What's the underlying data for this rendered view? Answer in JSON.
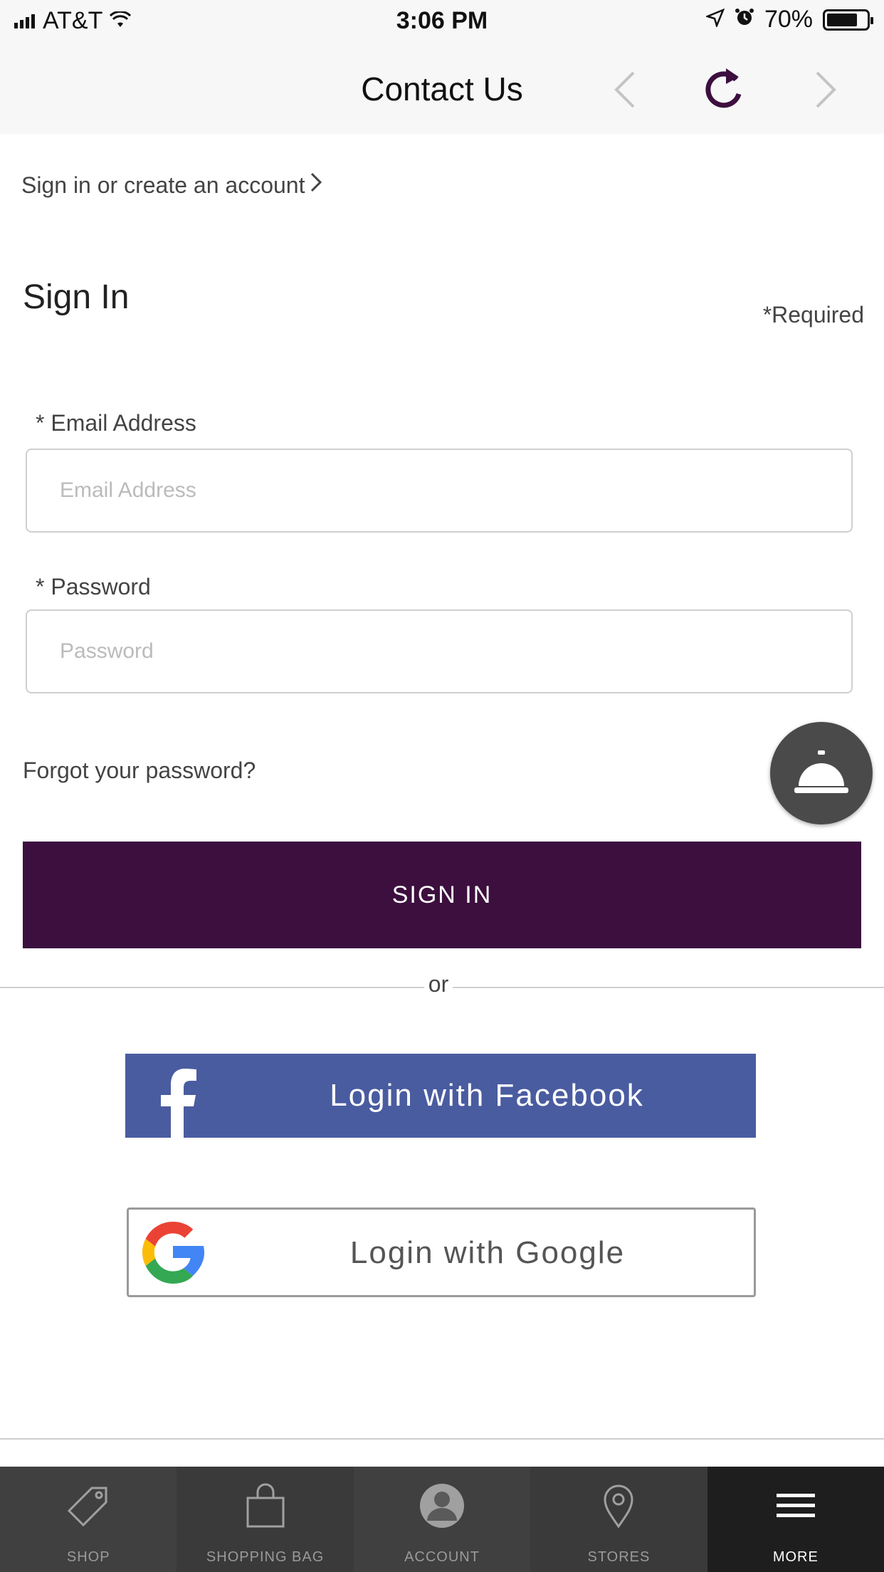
{
  "status_bar": {
    "carrier": "AT&T",
    "time": "3:06 PM",
    "battery": "70%"
  },
  "nav": {
    "title": "Contact Us"
  },
  "breadcrumb": {
    "label": "Sign in or create an account"
  },
  "page": {
    "title": "Sign In",
    "required_note": "*Required"
  },
  "email": {
    "label": "* Email Address",
    "placeholder": "Email Address",
    "value": ""
  },
  "password": {
    "label": "* Password",
    "placeholder": "Password",
    "value": ""
  },
  "forgot_password": "Forgot your password?",
  "sign_in_button": "SIGN IN",
  "or_text": "or",
  "facebook_button": "Login with Facebook",
  "google_button": "Login with Google",
  "colors": {
    "primary": "#3c0f3e",
    "facebook": "#4a5ca0"
  },
  "tabs": [
    {
      "label": "SHOP",
      "icon": "tag-icon",
      "active": false
    },
    {
      "label": "SHOPPING BAG",
      "icon": "bag-icon",
      "active": false
    },
    {
      "label": "ACCOUNT",
      "icon": "person-icon",
      "active": false
    },
    {
      "label": "STORES",
      "icon": "location-pin-icon",
      "active": false
    },
    {
      "label": "MORE",
      "icon": "menu-icon",
      "active": true
    }
  ]
}
